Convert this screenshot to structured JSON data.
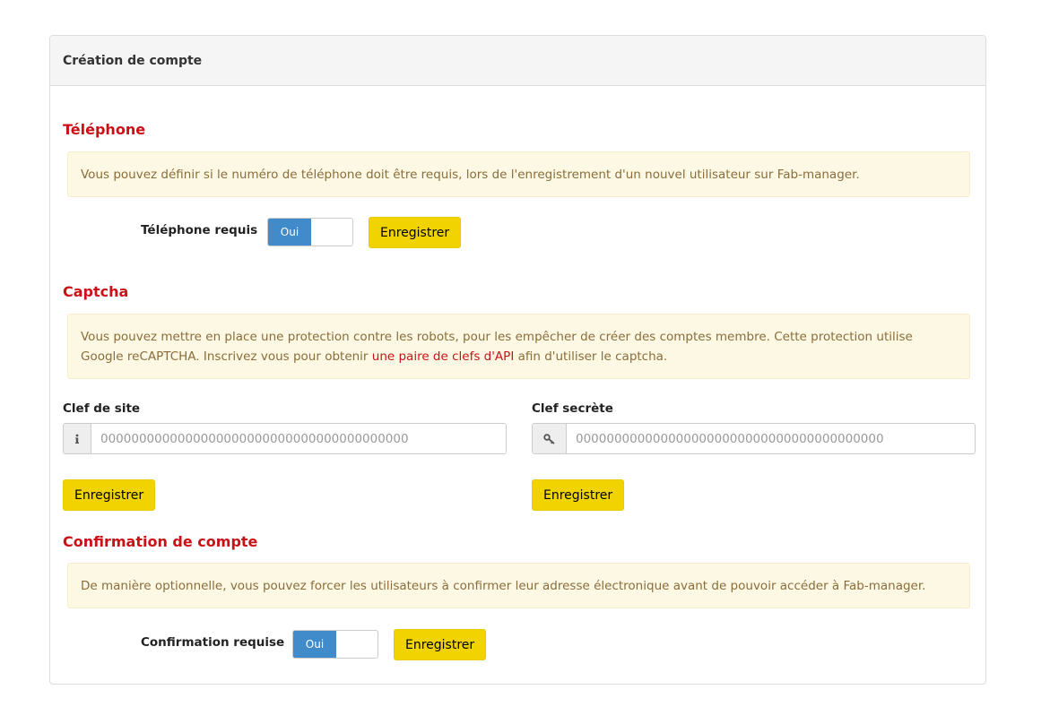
{
  "panel": {
    "title": "Création de compte"
  },
  "phone": {
    "title": "Téléphone",
    "info": "Vous pouvez définir si le numéro de téléphone doit être requis, lors de l'enregistrement d'un nouvel utilisateur sur Fab-manager.",
    "label": "Téléphone requis",
    "toggle_value": "Oui",
    "save_label": "Enregistrer"
  },
  "captcha": {
    "title": "Captcha",
    "info_before_link": "Vous pouvez mettre en place une protection contre les robots, pour les empêcher de créer des comptes membre. Cette protection utilise Google reCAPTCHA. Inscrivez vous pour obtenir ",
    "info_link": "une paire de clefs d'API",
    "info_after_link": " afin d'utiliser le captcha.",
    "site_key_label": "Clef de site",
    "site_key_placeholder": "0000000000000000000000000000000000000000",
    "secret_key_label": "Clef secrète",
    "secret_key_placeholder": "0000000000000000000000000000000000000000",
    "save_site_label": "Enregistrer",
    "save_secret_label": "Enregistrer"
  },
  "confirmation": {
    "title": "Confirmation de compte",
    "info": "De manière optionnelle, vous pouvez forcer les utilisateurs à confirmer leur adresse électronique avant de pouvoir accéder à Fab-manager.",
    "label": "Confirmation requise",
    "toggle_value": "Oui",
    "save_label": "Enregistrer"
  },
  "icons": {
    "site_key": "info-icon",
    "secret_key": "key-icon"
  }
}
